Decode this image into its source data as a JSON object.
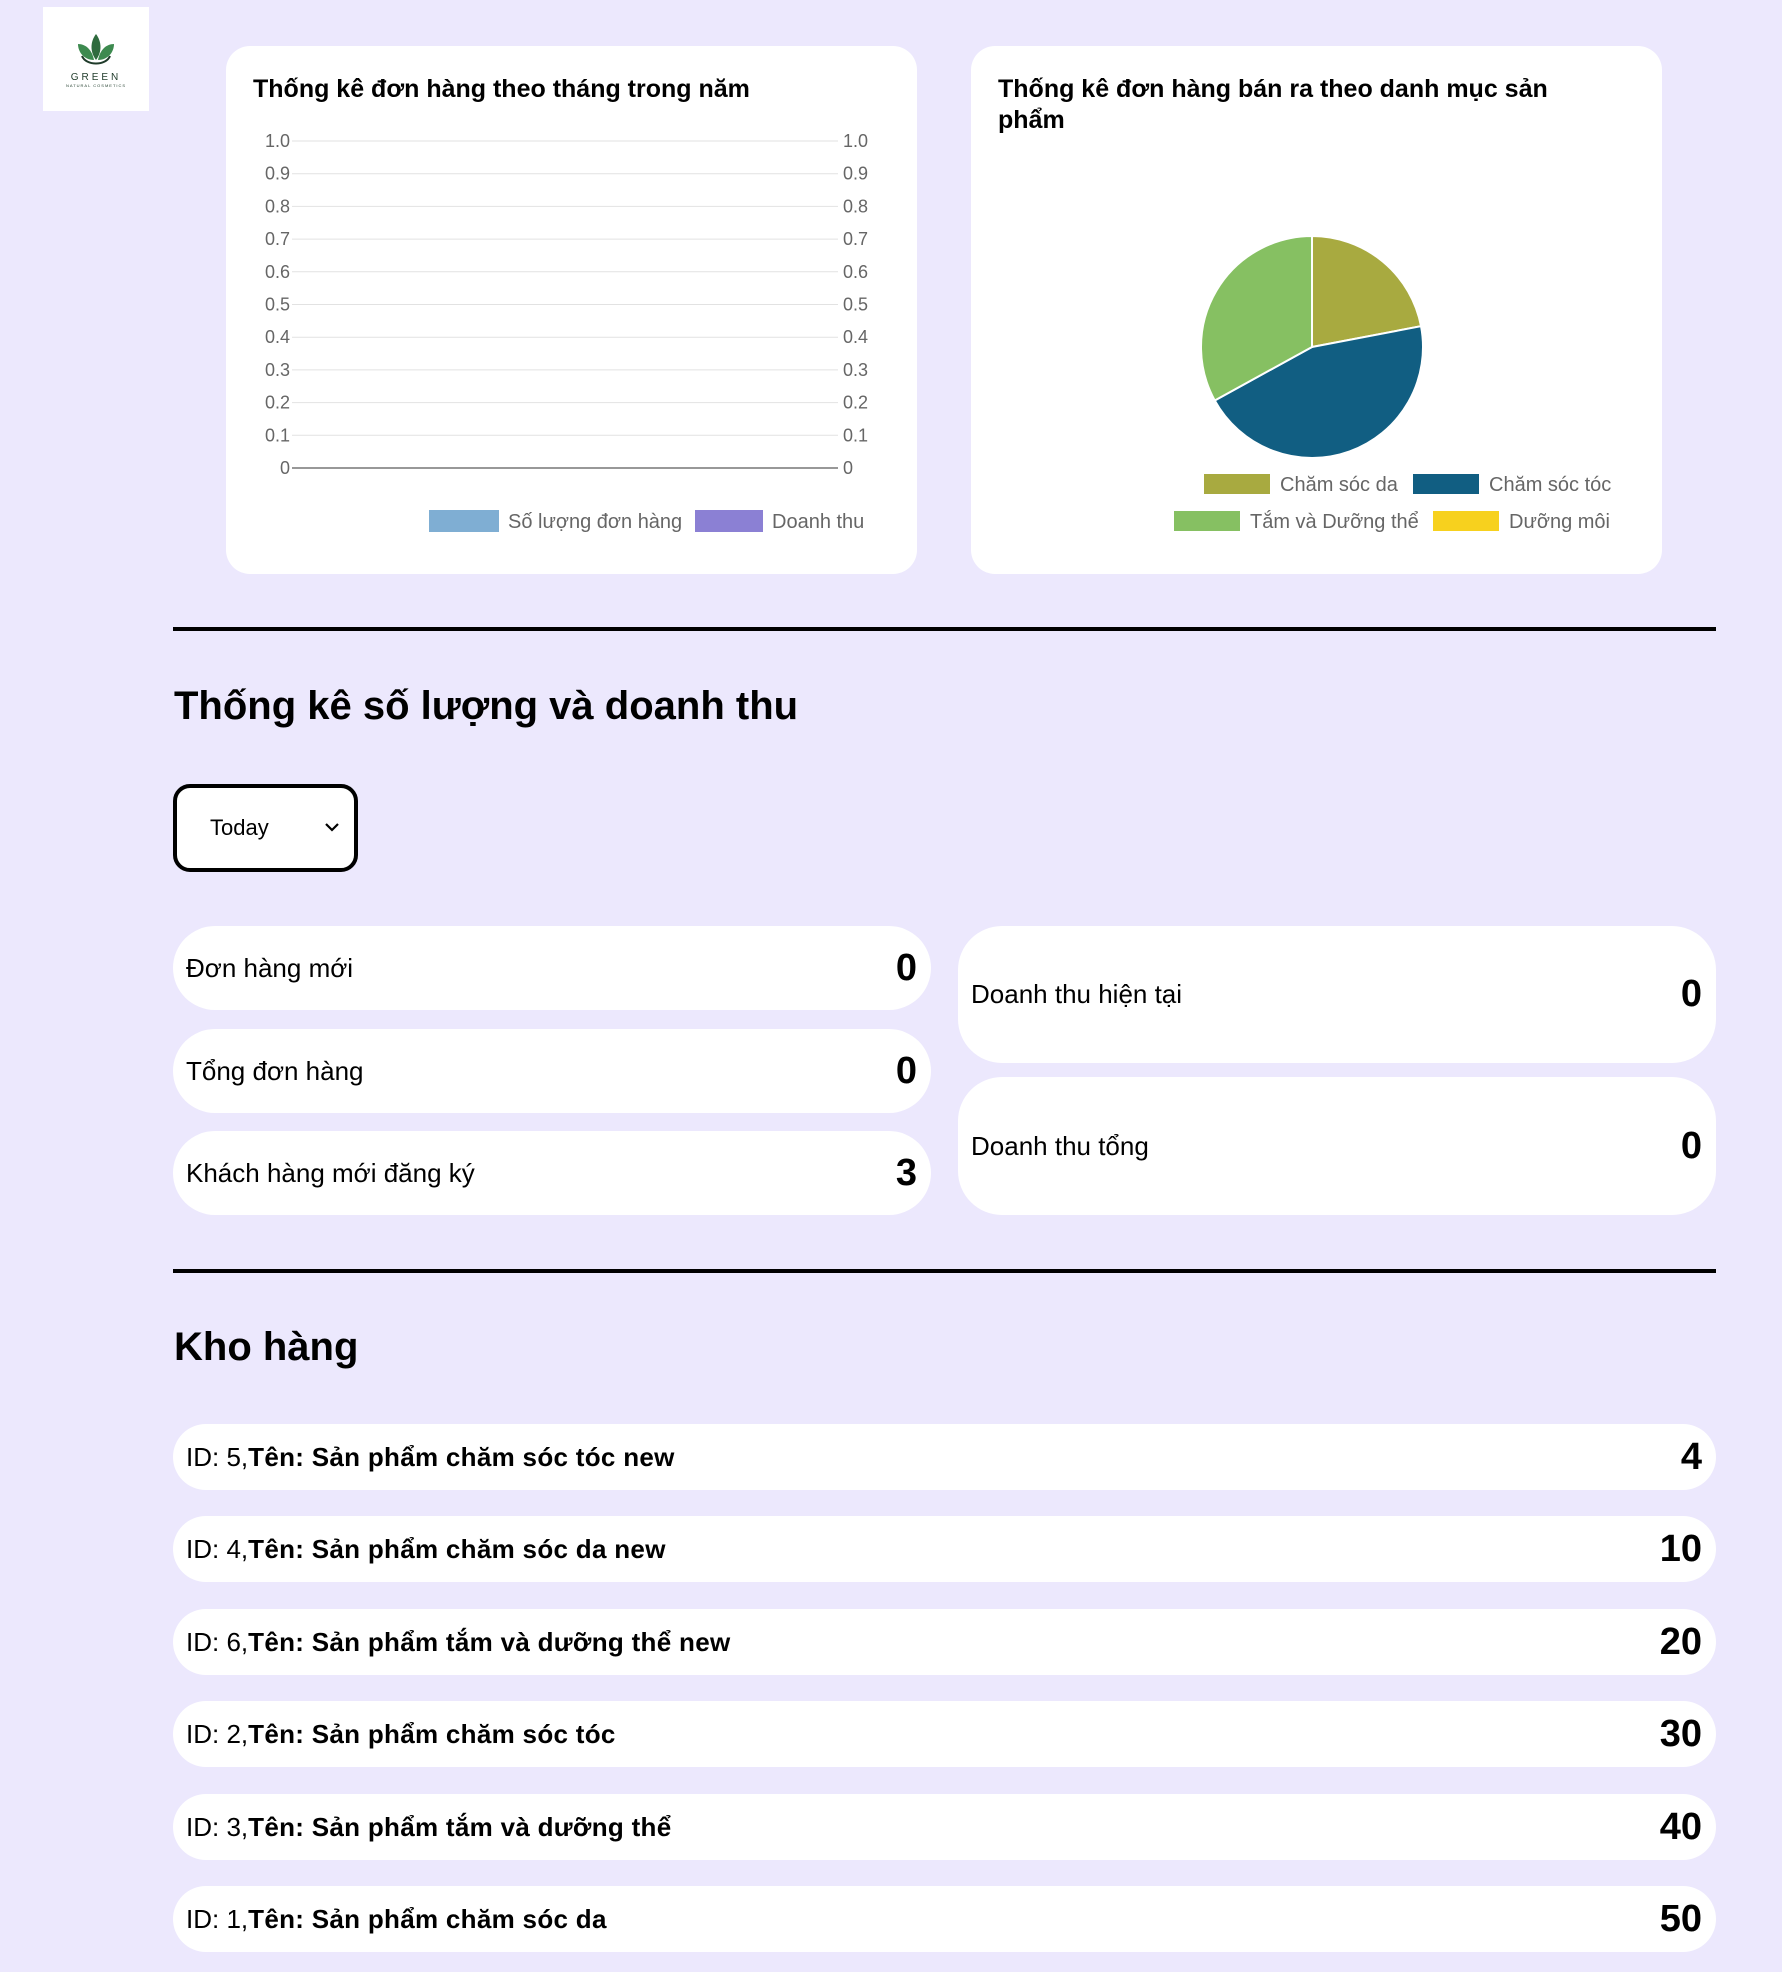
{
  "logo": {
    "brand": "GREEN",
    "tagline": "NATURAL COSMETICS"
  },
  "monthly_chart": {
    "title": "Thống kê đơn hàng theo tháng trong năm",
    "chart_data": {
      "type": "bar",
      "title": "Thống kê đơn hàng theo tháng trong năm",
      "categories": [],
      "series": [
        {
          "name": "Số lượng đơn hàng",
          "values": [],
          "color": "#7faed3"
        },
        {
          "name": "Doanh thu",
          "values": [],
          "color": "#8b80d4"
        }
      ],
      "ylim": [
        0,
        1.0
      ],
      "yticks": [
        "1.0",
        "0.9",
        "0.8",
        "0.7",
        "0.6",
        "0.5",
        "0.4",
        "0.3",
        "0.2",
        "0.1",
        "0"
      ],
      "dual_axis": true,
      "grid": true,
      "legend": "bottom"
    }
  },
  "category_chart": {
    "title": "Thống kê đơn hàng bán ra theo danh mục sản phẩm",
    "chart_data": {
      "type": "pie",
      "title": "Thống kê đơn hàng bán ra theo danh mục sản phẩm",
      "categories": [
        "Chăm sóc da",
        "Chăm sóc tóc",
        "Tắm và Dưỡng thể",
        "Dưỡng môi"
      ],
      "values": [
        22,
        45,
        33,
        0
      ],
      "colors": [
        "#a8aa40",
        "#115e82",
        "#86c062",
        "#f7d11e"
      ],
      "legend": "bottom"
    }
  },
  "stats_section": {
    "title": "Thống kê số lượng và doanh thu",
    "period": "Today",
    "new_orders": {
      "label": "Đơn hàng mới",
      "value": "0"
    },
    "total_orders": {
      "label": "Tổng đơn hàng",
      "value": "0"
    },
    "new_customers": {
      "label": "Khách hàng mới đăng ký",
      "value": "3"
    },
    "current_revenue": {
      "label": "Doanh thu hiện tại",
      "value": "0"
    },
    "total_revenue": {
      "label": "Doanh thu tổng",
      "value": "0"
    }
  },
  "inventory": {
    "title": "Kho hàng",
    "items": [
      {
        "id_text": "ID: 5,",
        "name_text": "Tên: Sản phẩm chăm sóc tóc new",
        "qty": "4"
      },
      {
        "id_text": "ID: 4,",
        "name_text": "Tên: Sản phẩm chăm sóc da new",
        "qty": "10"
      },
      {
        "id_text": "ID: 6,",
        "name_text": "Tên: Sản phẩm tắm và dưỡng thể new",
        "qty": "20"
      },
      {
        "id_text": "ID: 2,",
        "name_text": "Tên: Sản phẩm chăm sóc tóc",
        "qty": "30"
      },
      {
        "id_text": "ID: 3,",
        "name_text": "Tên: Sản phẩm tắm và dưỡng thể",
        "qty": "40"
      },
      {
        "id_text": "ID: 1,",
        "name_text": "Tên: Sản phẩm chăm sóc da",
        "qty": "50"
      }
    ]
  }
}
